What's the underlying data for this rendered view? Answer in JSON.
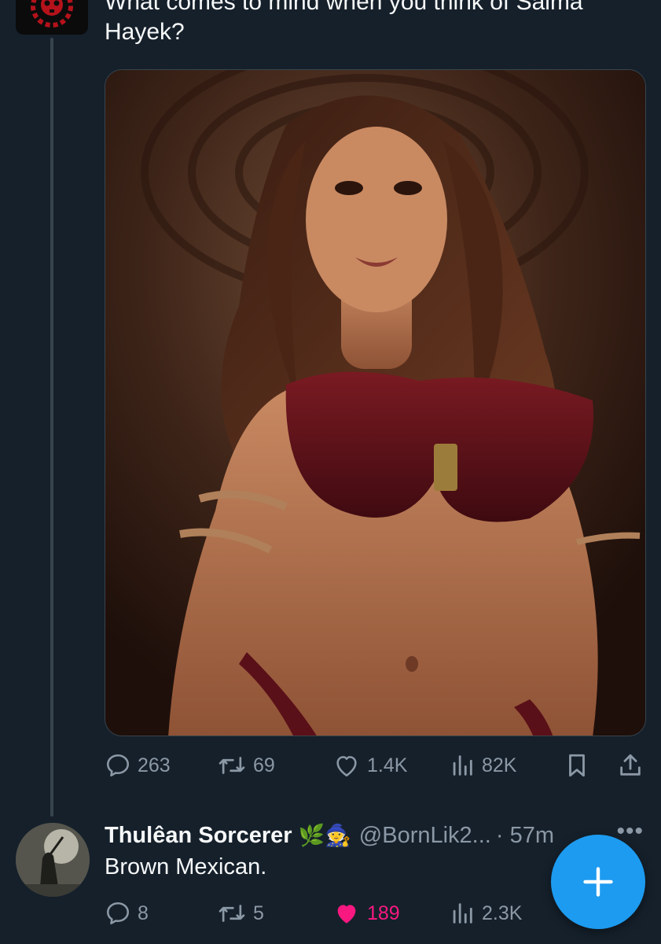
{
  "colors": {
    "background": "#15202b",
    "text_primary": "#f7f9f9",
    "text_secondary": "#8b98a5",
    "accent": "#1d9bf0",
    "like_active": "#f91880"
  },
  "tweet": {
    "text": "What comes to mind when you think of Salma Hayek?",
    "stats": {
      "replies": "263",
      "retweets": "69",
      "likes": "1.4K",
      "views": "82K"
    }
  },
  "reply": {
    "display_name": "Thulêan Sorcerer",
    "emojis": "🌿🧙",
    "handle": "@BornLik2...",
    "time": "· 57m",
    "more_label": "•••",
    "text": "Brown Mexican.",
    "stats": {
      "replies": "8",
      "retweets": "5",
      "likes": "189",
      "views": "2.3K"
    }
  },
  "icons": {
    "reply": "reply-icon",
    "retweet": "retweet-icon",
    "like": "heart-icon",
    "views": "views-icon",
    "bookmark": "bookmark-icon",
    "share": "share-icon",
    "compose": "plus-icon"
  }
}
